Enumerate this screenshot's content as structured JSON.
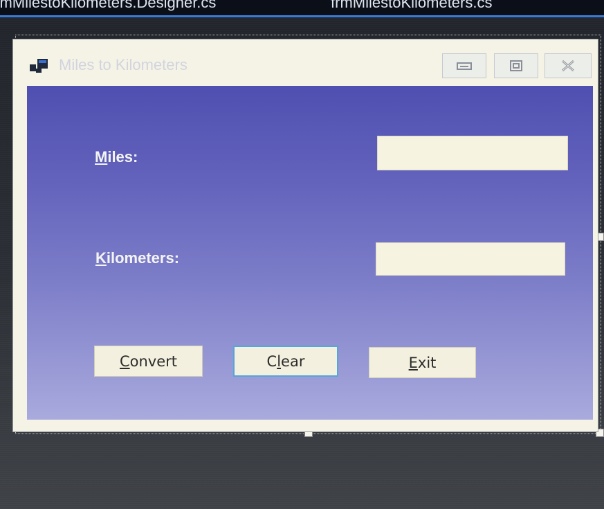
{
  "ide": {
    "tabs": [
      {
        "label": "frmMilestoKilometers.Designer.cs"
      },
      {
        "label": "frmMilestoKilometers.cs"
      }
    ]
  },
  "form": {
    "title": "Miles to Kilometers",
    "caption_buttons": {
      "minimize": "minimize-icon",
      "maximize": "maximize-icon",
      "close": "close-icon"
    },
    "background_top": "#4f4fb1",
    "background_bottom": "#a9aadd",
    "miles_label": {
      "mnemonic": "M",
      "rest": "iles:"
    },
    "kilometers_label": {
      "mnemonic": "K",
      "rest": "ilometers:"
    },
    "miles_input": {
      "value": "",
      "placeholder": ""
    },
    "kilometers_input": {
      "value": "",
      "placeholder": ""
    },
    "buttons": {
      "convert": {
        "mnemonic": "C",
        "rest": "onvert"
      },
      "clear": {
        "pre": "C",
        "mnemonic": "l",
        "rest": "ear"
      },
      "exit": {
        "mnemonic": "E",
        "rest": "xit"
      }
    }
  }
}
